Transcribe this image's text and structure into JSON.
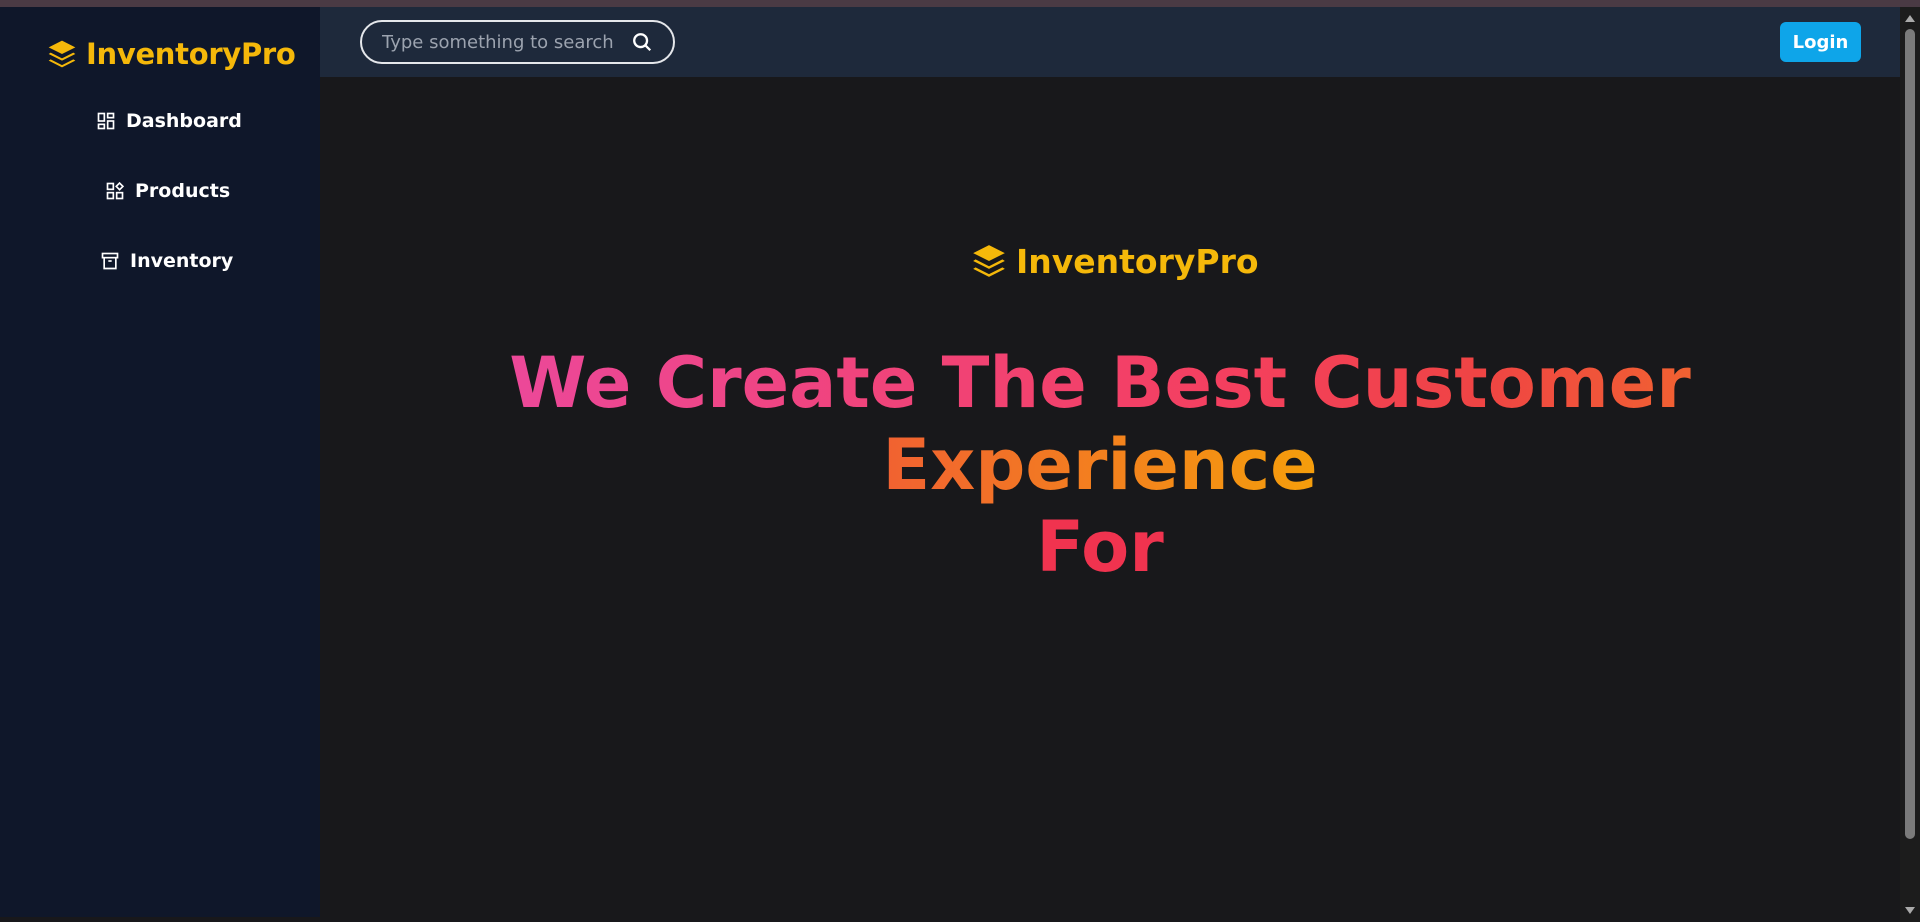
{
  "brand": {
    "name": "InventoryPro",
    "icon": "layers-icon",
    "color": "#f5b80a"
  },
  "sidebar": {
    "items": [
      {
        "label": "Dashboard",
        "icon": "dashboard-icon"
      },
      {
        "label": "Products",
        "icon": "products-icon"
      },
      {
        "label": "Inventory",
        "icon": "archive-icon"
      }
    ]
  },
  "topbar": {
    "search": {
      "placeholder": "Type something to search",
      "value": "",
      "icon": "search-icon"
    },
    "login_label": "Login",
    "login_color": "#0ea5e9"
  },
  "hero": {
    "brand_name": "InventoryPro",
    "headline_line1": "We Create The Best Customer Experience",
    "headline_line2": "For"
  }
}
